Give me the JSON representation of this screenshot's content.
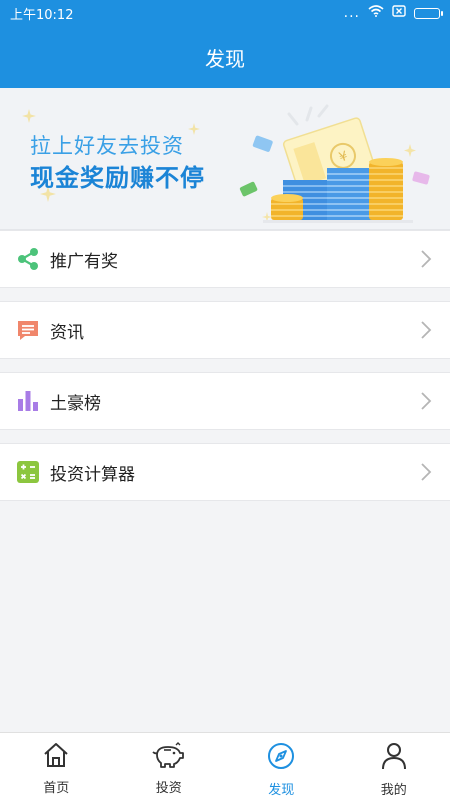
{
  "status": {
    "time": "上午10:12",
    "dots": "..."
  },
  "header": {
    "title": "发现"
  },
  "banner": {
    "line1": "拉上好友去投资",
    "line2": "现金奖励赚不停"
  },
  "menu": [
    {
      "label": "推广有奖",
      "icon": "share-icon"
    },
    {
      "label": "资讯",
      "icon": "news-icon"
    },
    {
      "label": "土豪榜",
      "icon": "bar-chart-icon"
    },
    {
      "label": "投资计算器",
      "icon": "calculator-icon"
    }
  ],
  "tabs": [
    {
      "label": "首页",
      "icon": "home-icon",
      "active": false
    },
    {
      "label": "投资",
      "icon": "piggy-bank-icon",
      "active": false
    },
    {
      "label": "发现",
      "icon": "compass-icon",
      "active": true
    },
    {
      "label": "我的",
      "icon": "user-icon",
      "active": false
    }
  ],
  "colors": {
    "primary": "#1e90e0",
    "share": "#4cc37a",
    "news": "#f0866b",
    "rank": "#a87ce6",
    "calc": "#8cc63f"
  }
}
